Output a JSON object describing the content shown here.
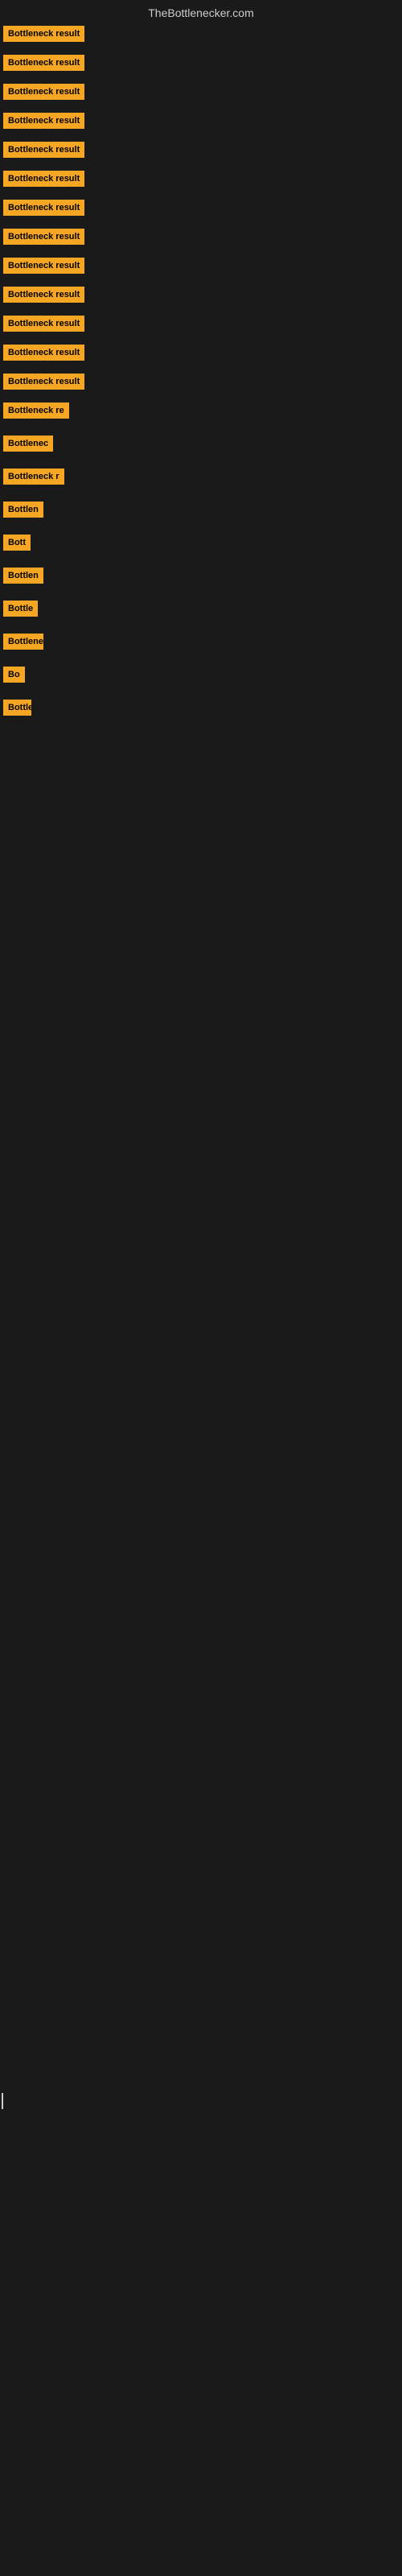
{
  "site": {
    "title": "TheBottlenecker.com"
  },
  "items": [
    {
      "id": 1,
      "label": "Bottleneck result",
      "size_class": "badge-full"
    },
    {
      "id": 2,
      "label": "Bottleneck result",
      "size_class": "badge-full"
    },
    {
      "id": 3,
      "label": "Bottleneck result",
      "size_class": "badge-full"
    },
    {
      "id": 4,
      "label": "Bottleneck result",
      "size_class": "badge-full"
    },
    {
      "id": 5,
      "label": "Bottleneck result",
      "size_class": "badge-full"
    },
    {
      "id": 6,
      "label": "Bottleneck result",
      "size_class": "badge-full"
    },
    {
      "id": 7,
      "label": "Bottleneck result",
      "size_class": "badge-full"
    },
    {
      "id": 8,
      "label": "Bottleneck result",
      "size_class": "badge-full"
    },
    {
      "id": 9,
      "label": "Bottleneck result",
      "size_class": "badge-full"
    },
    {
      "id": 10,
      "label": "Bottleneck result",
      "size_class": "badge-full"
    },
    {
      "id": 11,
      "label": "Bottleneck result",
      "size_class": "badge-full"
    },
    {
      "id": 12,
      "label": "Bottleneck result",
      "size_class": "badge-full"
    },
    {
      "id": 13,
      "label": "Bottleneck result",
      "size_class": "badge-full"
    },
    {
      "id": 14,
      "label": "Bottleneck re",
      "size_class": "badge-l1"
    },
    {
      "id": 15,
      "label": "Bottlenec",
      "size_class": "badge-l2"
    },
    {
      "id": 16,
      "label": "Bottleneck r",
      "size_class": "badge-l3"
    },
    {
      "id": 17,
      "label": "Bottlen",
      "size_class": "badge-l4"
    },
    {
      "id": 18,
      "label": "Bott",
      "size_class": "badge-l5"
    },
    {
      "id": 19,
      "label": "Bottlen",
      "size_class": "badge-l4"
    },
    {
      "id": 20,
      "label": "Bottle",
      "size_class": "badge-l6"
    },
    {
      "id": 21,
      "label": "Bottlenec",
      "size_class": "badge-l7"
    },
    {
      "id": 22,
      "label": "Bo",
      "size_class": "badge-l8"
    },
    {
      "id": 23,
      "label": "Bottlen",
      "size_class": "badge-l9"
    }
  ]
}
